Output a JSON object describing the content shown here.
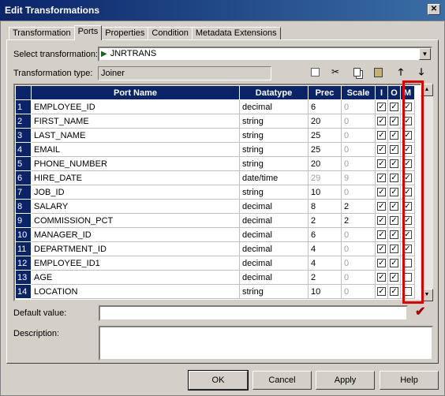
{
  "window": {
    "title": "Edit Transformations",
    "close_label": "✕"
  },
  "tabs": [
    {
      "label": "Transformation",
      "active": false
    },
    {
      "label": "Ports",
      "active": true
    },
    {
      "label": "Properties",
      "active": false
    },
    {
      "label": "Condition",
      "active": false
    },
    {
      "label": "Metadata Extensions",
      "active": false
    }
  ],
  "select_transformation": {
    "label": "Select transformation:",
    "value": "JNRTRANS",
    "icon": "joiner-icon"
  },
  "transformation_type": {
    "label": "Transformation type:",
    "value": "Joiner"
  },
  "grid": {
    "headers": [
      "Port Name",
      "Datatype",
      "Prec",
      "Scale",
      "I",
      "O",
      "M"
    ],
    "rows": [
      {
        "n": "1",
        "name": "EMPLOYEE_ID",
        "type": "decimal",
        "prec": "6",
        "scale": "0",
        "i": true,
        "o": true,
        "m": true,
        "muted": false
      },
      {
        "n": "2",
        "name": "FIRST_NAME",
        "type": "string",
        "prec": "20",
        "scale": "0",
        "i": true,
        "o": true,
        "m": true,
        "muted": false
      },
      {
        "n": "3",
        "name": "LAST_NAME",
        "type": "string",
        "prec": "25",
        "scale": "0",
        "i": true,
        "o": true,
        "m": true,
        "muted": false
      },
      {
        "n": "4",
        "name": "EMAIL",
        "type": "string",
        "prec": "25",
        "scale": "0",
        "i": true,
        "o": true,
        "m": true,
        "muted": false
      },
      {
        "n": "5",
        "name": "PHONE_NUMBER",
        "type": "string",
        "prec": "20",
        "scale": "0",
        "i": true,
        "o": true,
        "m": true,
        "muted": false
      },
      {
        "n": "6",
        "name": "HIRE_DATE",
        "type": "date/time",
        "prec": "29",
        "scale": "9",
        "i": true,
        "o": true,
        "m": true,
        "muted": true
      },
      {
        "n": "7",
        "name": "JOB_ID",
        "type": "string",
        "prec": "10",
        "scale": "0",
        "i": true,
        "o": true,
        "m": true,
        "muted": false
      },
      {
        "n": "8",
        "name": "SALARY",
        "type": "decimal",
        "prec": "8",
        "scale": "2",
        "i": true,
        "o": true,
        "m": true,
        "muted": false
      },
      {
        "n": "9",
        "name": "COMMISSION_PCT",
        "type": "decimal",
        "prec": "2",
        "scale": "2",
        "i": true,
        "o": true,
        "m": true,
        "muted": false
      },
      {
        "n": "10",
        "name": "MANAGER_ID",
        "type": "decimal",
        "prec": "6",
        "scale": "0",
        "i": true,
        "o": true,
        "m": true,
        "muted": false
      },
      {
        "n": "11",
        "name": "DEPARTMENT_ID",
        "type": "decimal",
        "prec": "4",
        "scale": "0",
        "i": true,
        "o": true,
        "m": true,
        "muted": false
      },
      {
        "n": "12",
        "name": "EMPLOYEE_ID1",
        "type": "decimal",
        "prec": "4",
        "scale": "0",
        "i": true,
        "o": true,
        "m": false,
        "muted": false
      },
      {
        "n": "13",
        "name": "AGE",
        "type": "decimal",
        "prec": "2",
        "scale": "0",
        "i": true,
        "o": true,
        "m": false,
        "muted": false
      },
      {
        "n": "14",
        "name": "LOCATION",
        "type": "string",
        "prec": "10",
        "scale": "0",
        "i": true,
        "o": true,
        "m": false,
        "muted": false
      }
    ]
  },
  "default_value": {
    "label": "Default value:",
    "value": ""
  },
  "description": {
    "label": "Description:",
    "value": ""
  },
  "buttons": {
    "ok": "OK",
    "cancel": "Cancel",
    "apply": "Apply",
    "help": "Help"
  },
  "colors": {
    "header_bg": "#0a246a",
    "highlight": "#e00000",
    "validate": "#a00000"
  }
}
